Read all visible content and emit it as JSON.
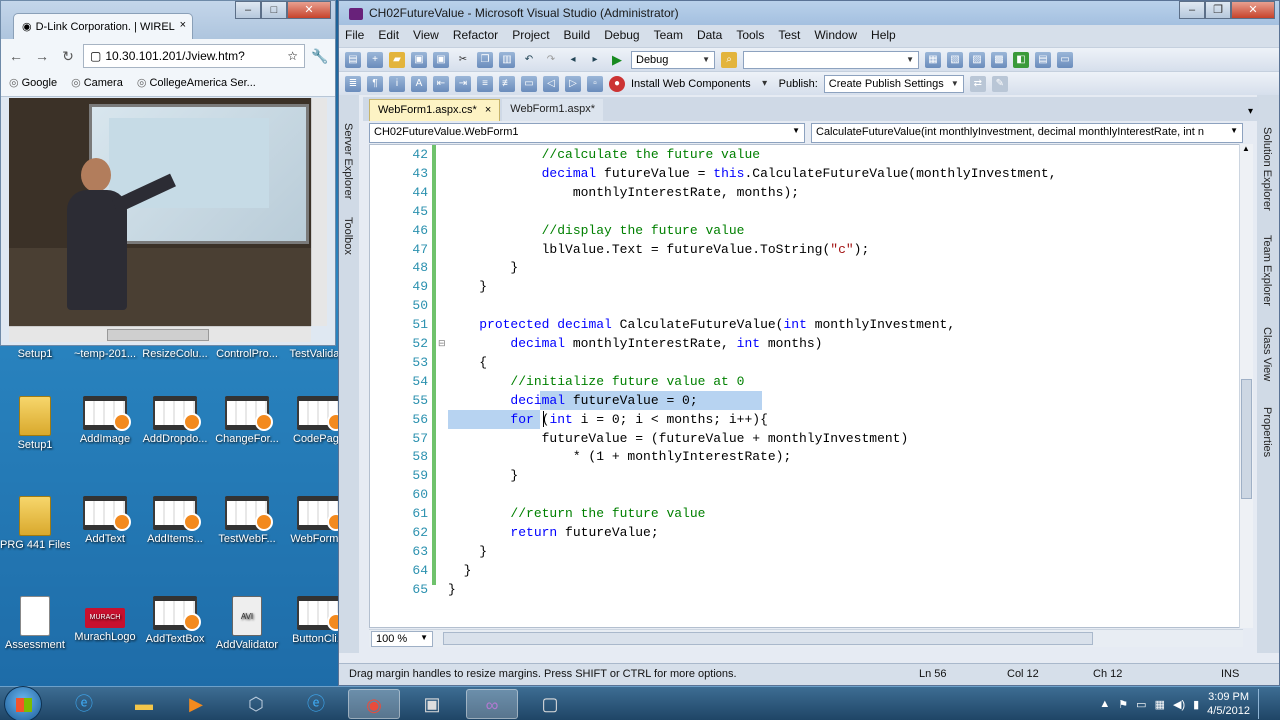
{
  "chrome": {
    "tab_title": "D-Link Corporation. | WIREL",
    "url": "10.30.101.201/Jview.htm?",
    "bookmarks": [
      "Google",
      "Camera",
      "CollegeAmerica Ser..."
    ]
  },
  "desktop": {
    "top_row": [
      "Setup1",
      "~temp-201...",
      "ResizeColu...",
      "ControlPro...",
      "TestValida..."
    ],
    "icons": [
      {
        "label": "Setup1",
        "kind": "folder"
      },
      {
        "label": "AddImage",
        "kind": "film"
      },
      {
        "label": "AddDropdo...",
        "kind": "film"
      },
      {
        "label": "ChangeFor...",
        "kind": "film"
      },
      {
        "label": "CodePage",
        "kind": "film"
      },
      {
        "label": "PRG 441 Files",
        "kind": "folder"
      },
      {
        "label": "AddText",
        "kind": "film"
      },
      {
        "label": "AddItems...",
        "kind": "film"
      },
      {
        "label": "TestWebF...",
        "kind": "film"
      },
      {
        "label": "WebForm...",
        "kind": "film"
      },
      {
        "label": "Assessment",
        "kind": "doc"
      },
      {
        "label": "MurachLogo",
        "kind": "murach"
      },
      {
        "label": "AddTextBox",
        "kind": "film"
      },
      {
        "label": "AddValidator",
        "kind": "avi"
      },
      {
        "label": "ButtonCli...",
        "kind": "film"
      }
    ],
    "murach_text": "MURACH",
    "avi_text": "AVI"
  },
  "vs": {
    "title": "CH02FutureValue - Microsoft Visual Studio (Administrator)",
    "menu": [
      "File",
      "Edit",
      "View",
      "Refactor",
      "Project",
      "Build",
      "Debug",
      "Team",
      "Data",
      "Tools",
      "Test",
      "Window",
      "Help"
    ],
    "config": "Debug",
    "install_web": "Install Web Components",
    "publish_label": "Publish:",
    "publish_value": "Create Publish Settings",
    "left_strip": [
      "Server Explorer",
      "Toolbox"
    ],
    "right_strip": [
      "Solution Explorer",
      "Team Explorer",
      "Class View",
      "Properties"
    ],
    "tabs": [
      {
        "label": "WebForm1.aspx.cs*",
        "close": "×"
      },
      {
        "label": "WebForm1.aspx*"
      }
    ],
    "nav_class": "CH02FutureValue.WebForm1",
    "nav_member": "CalculateFutureValue(int monthlyInvestment, decimal monthlyInterestRate, int n",
    "zoom": "100 %",
    "status": {
      "message": "Drag margin handles to resize margins. Press SHIFT or CTRL for more options.",
      "ln": "Ln 56",
      "col": "Col 12",
      "ch": "Ch 12",
      "mode": "INS"
    },
    "lines": [
      {
        "n": "42",
        "t": "            //calculate the future value"
      },
      {
        "n": "43",
        "t": "            decimal futureValue = this.CalculateFutureValue(monthlyInvestment,"
      },
      {
        "n": "44",
        "t": "                monthlyInterestRate, months);"
      },
      {
        "n": "45",
        "t": ""
      },
      {
        "n": "46",
        "t": "            //display the future value"
      },
      {
        "n": "47",
        "t": "            lblValue.Text = futureValue.ToString(\"c\");"
      },
      {
        "n": "48",
        "t": "        }"
      },
      {
        "n": "49",
        "t": "    }"
      },
      {
        "n": "50",
        "t": ""
      },
      {
        "n": "51",
        "t": "    protected decimal CalculateFutureValue(int monthlyInvestment,"
      },
      {
        "n": "52",
        "t": "        decimal monthlyInterestRate, int months)"
      },
      {
        "n": "53",
        "t": "    {"
      },
      {
        "n": "54",
        "t": "        //initialize future value at 0"
      },
      {
        "n": "55",
        "t": "        decimal futureValue = 0;"
      },
      {
        "n": "56",
        "t": "        for (int i = 0; i < months; i++){"
      },
      {
        "n": "57",
        "t": "            futureValue = (futureValue + monthlyInvestment)"
      },
      {
        "n": "58",
        "t": "                * (1 + monthlyInterestRate);"
      },
      {
        "n": "59",
        "t": "        }"
      },
      {
        "n": "60",
        "t": ""
      },
      {
        "n": "61",
        "t": "        //return the future value"
      },
      {
        "n": "62",
        "t": "        return futureValue;"
      },
      {
        "n": "63",
        "t": "    }"
      },
      {
        "n": "64",
        "t": "  }"
      },
      {
        "n": "65",
        "t": "}"
      }
    ]
  },
  "taskbar": {
    "time": "3:09 PM",
    "date": "4/5/2012"
  }
}
